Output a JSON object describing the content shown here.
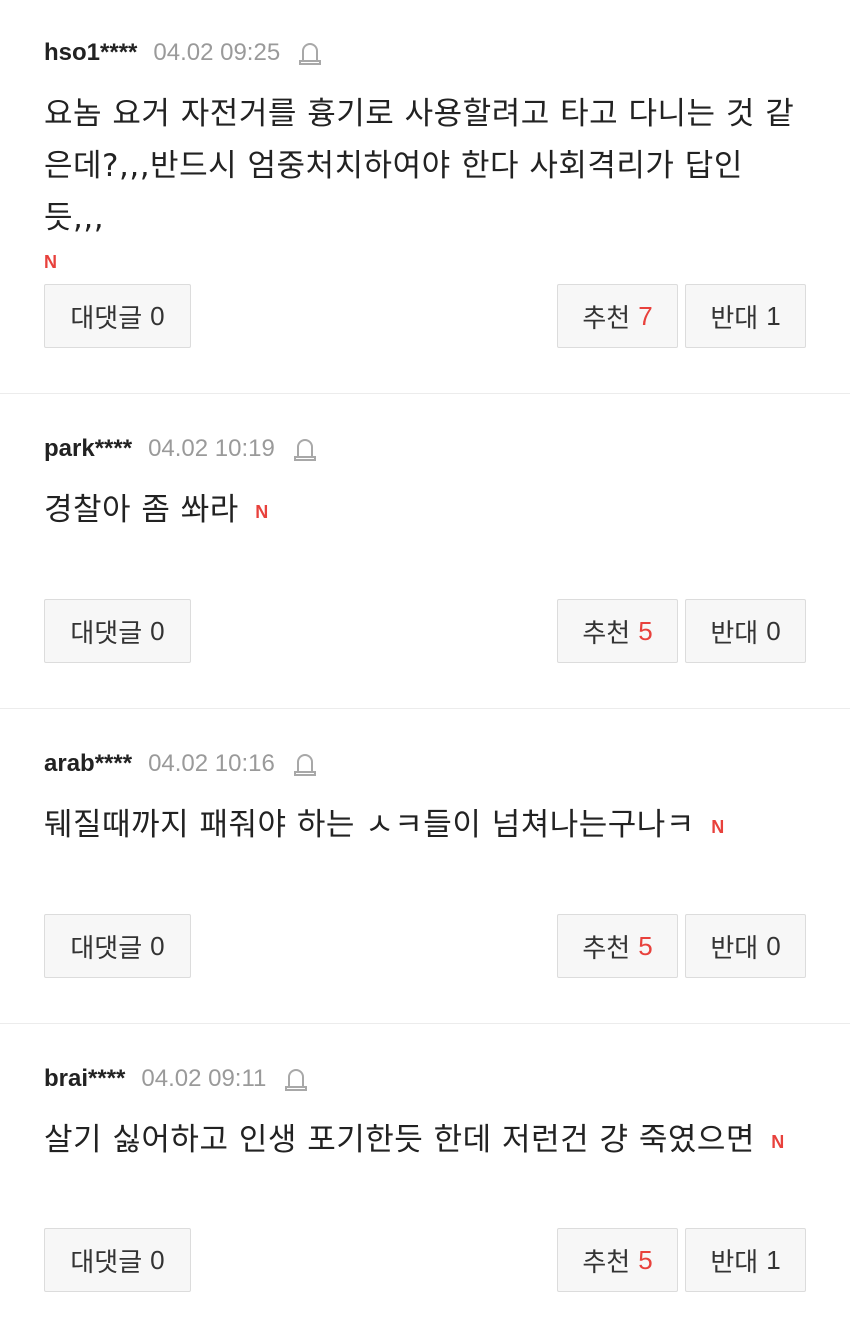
{
  "comments": [
    {
      "author": "hso1****",
      "date": "04.02 09:25",
      "text": "요놈 요거 자전거를 흉기로 사용할려고 타고 다니는 것 같은데?,,,반드시 엄중처치하여야 한다 사회격리가 답인 듯,,,",
      "new_badge": "N",
      "reply_label": "대댓글",
      "reply_count": "0",
      "up_label": "추천",
      "up_count": "7",
      "down_label": "반대",
      "down_count": "1"
    },
    {
      "author": "park****",
      "date": "04.02 10:19",
      "text": "경찰아 좀 쏴라",
      "new_badge": "N",
      "reply_label": "대댓글",
      "reply_count": "0",
      "up_label": "추천",
      "up_count": "5",
      "down_label": "반대",
      "down_count": "0"
    },
    {
      "author": "arab****",
      "date": "04.02 10:16",
      "text": "뒈질때까지 패줘야 하는 ㅅㅋ들이 넘쳐나는구나ㅋ",
      "new_badge": "N",
      "reply_label": "대댓글",
      "reply_count": "0",
      "up_label": "추천",
      "up_count": "5",
      "down_label": "반대",
      "down_count": "0"
    },
    {
      "author": "brai****",
      "date": "04.02 09:11",
      "text": "살기 싫어하고 인생 포기한듯 한데 저런건 걍 죽였으면",
      "new_badge": "N",
      "reply_label": "대댓글",
      "reply_count": "0",
      "up_label": "추천",
      "up_count": "5",
      "down_label": "반대",
      "down_count": "1"
    }
  ],
  "colors": {
    "accent_red": "#e8413c",
    "date_gray": "#9a9a9a"
  },
  "icons": {
    "report": "siren-report-icon",
    "new": "new-badge"
  }
}
